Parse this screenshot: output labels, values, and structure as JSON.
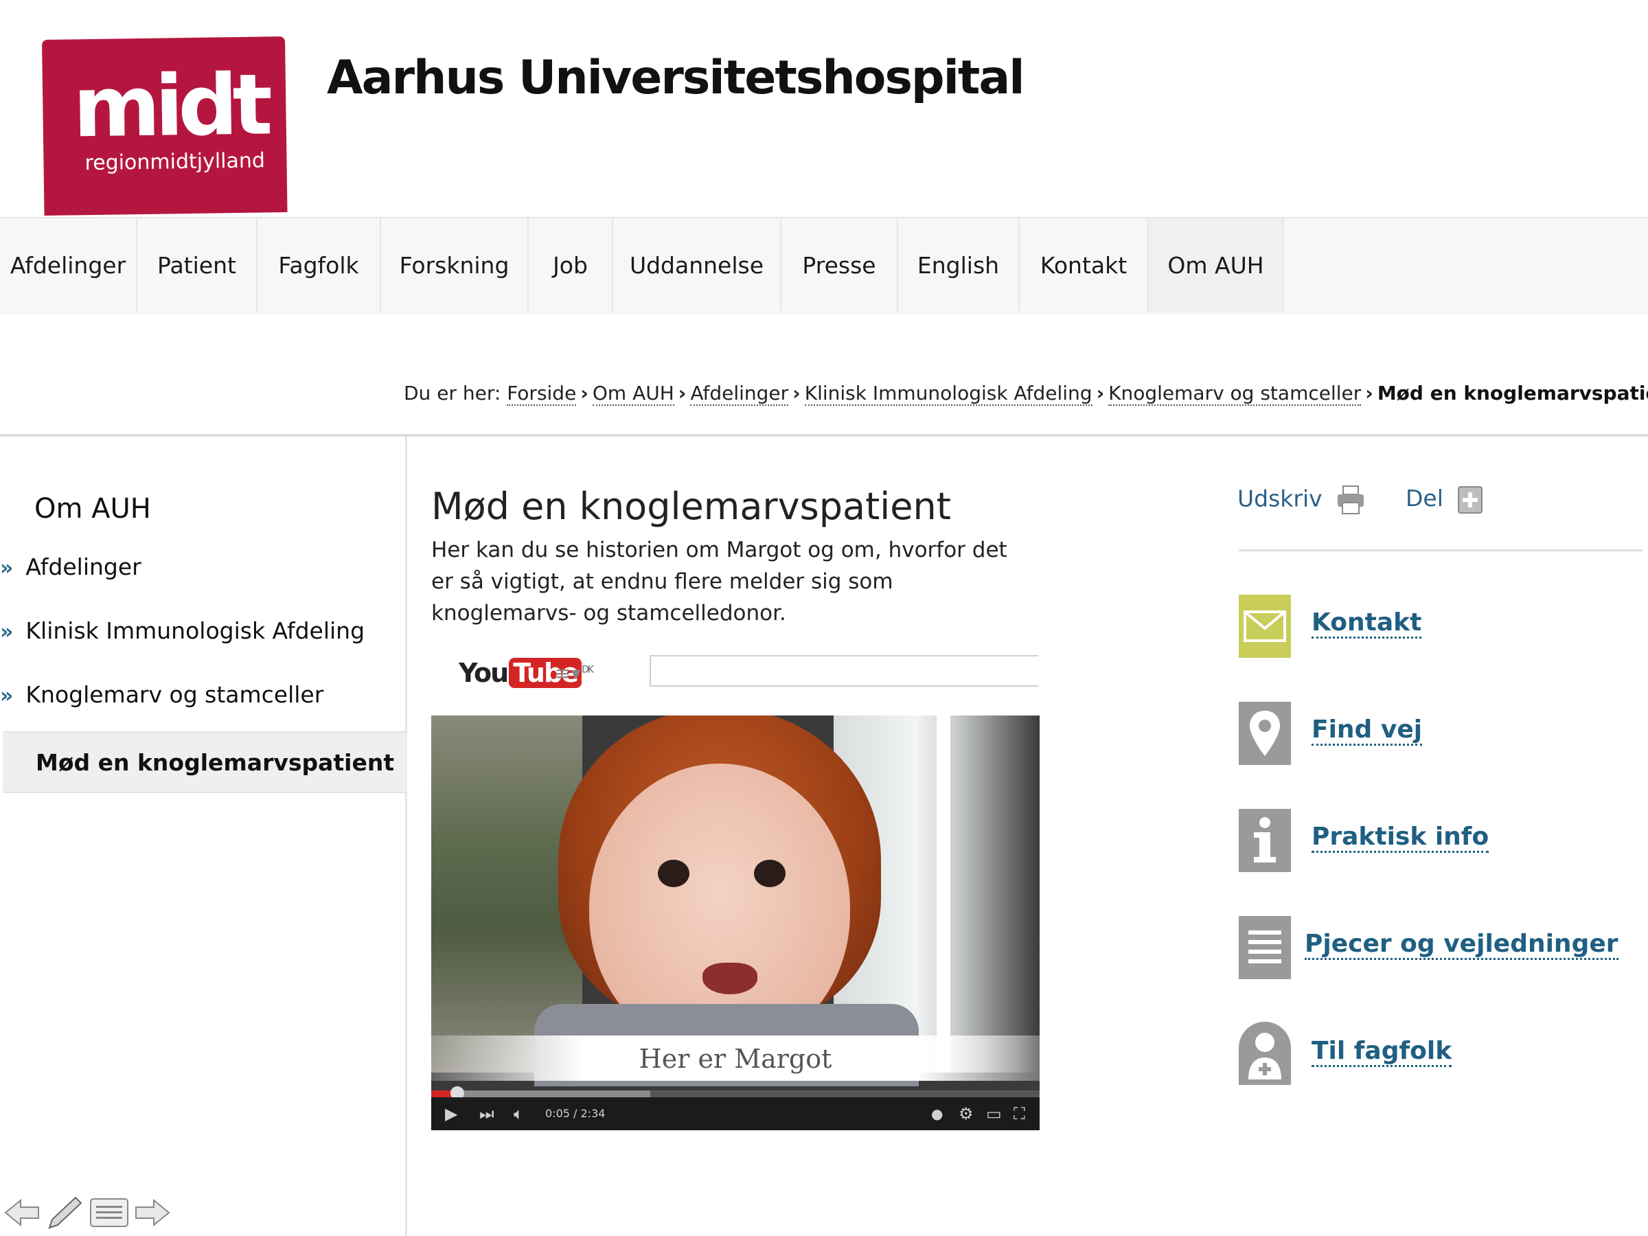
{
  "header": {
    "logo_word": "midt",
    "logo_sub": "regionmidtjylland",
    "site_title": "Aarhus Universitetshospital"
  },
  "nav": {
    "items": [
      {
        "label": "Afdelinger"
      },
      {
        "label": "Patient"
      },
      {
        "label": "Fagfolk"
      },
      {
        "label": "Forskning"
      },
      {
        "label": "Job"
      },
      {
        "label": "Uddannelse"
      },
      {
        "label": "Presse"
      },
      {
        "label": "English"
      },
      {
        "label": "Kontakt"
      },
      {
        "label": "Om AUH"
      }
    ],
    "active": "Om AUH"
  },
  "breadcrumb": {
    "prefix": "Du er her:",
    "items": [
      "Forside",
      "Om AUH",
      "Afdelinger",
      "Klinisk Immunologisk Afdeling",
      "Knoglemarv og stamceller"
    ],
    "current": "Mød en knoglemarvspatient"
  },
  "subnav": {
    "title": "Om AUH",
    "items": [
      "Afdelinger",
      "Klinisk Immunologisk Afdeling",
      "Knoglemarv og stamceller"
    ],
    "active": "Mød en knoglemarvspatient"
  },
  "main": {
    "title": "Mød en knoglemarvspatient",
    "intro": "Her kan du se historien om Margot og om, hvorfor det er så vigtigt, at endnu flere melder sig som knoglemarvs- og stamcelledonor."
  },
  "video": {
    "brand_you": "You",
    "brand_tube": "Tube",
    "region": "DK",
    "caption": "Her er Margot",
    "time": "0:05 / 2:34",
    "progress": 0.036,
    "buffered": 0.36,
    "colors": {
      "progress": "#d42525",
      "brand": "#d42525"
    }
  },
  "tools": {
    "print": "Udskriv",
    "share": "Del"
  },
  "side_links": [
    {
      "label": "Kontakt",
      "icon": "envelope-icon",
      "color": "#c9cd5a"
    },
    {
      "label": "Find vej",
      "icon": "map-pin-icon",
      "color": "#9a9a9a"
    },
    {
      "label": "Praktisk info",
      "icon": "info-icon",
      "color": "#9a9a9a"
    },
    {
      "label": "Pjecer og vejledninger",
      "icon": "document-icon",
      "color": "#9a9a9a"
    },
    {
      "label": "Til fagfolk",
      "icon": "doctor-icon",
      "color": "#9a9a9a"
    }
  ],
  "colors": {
    "brand": "#b5163f",
    "link": "#1f5f82"
  }
}
